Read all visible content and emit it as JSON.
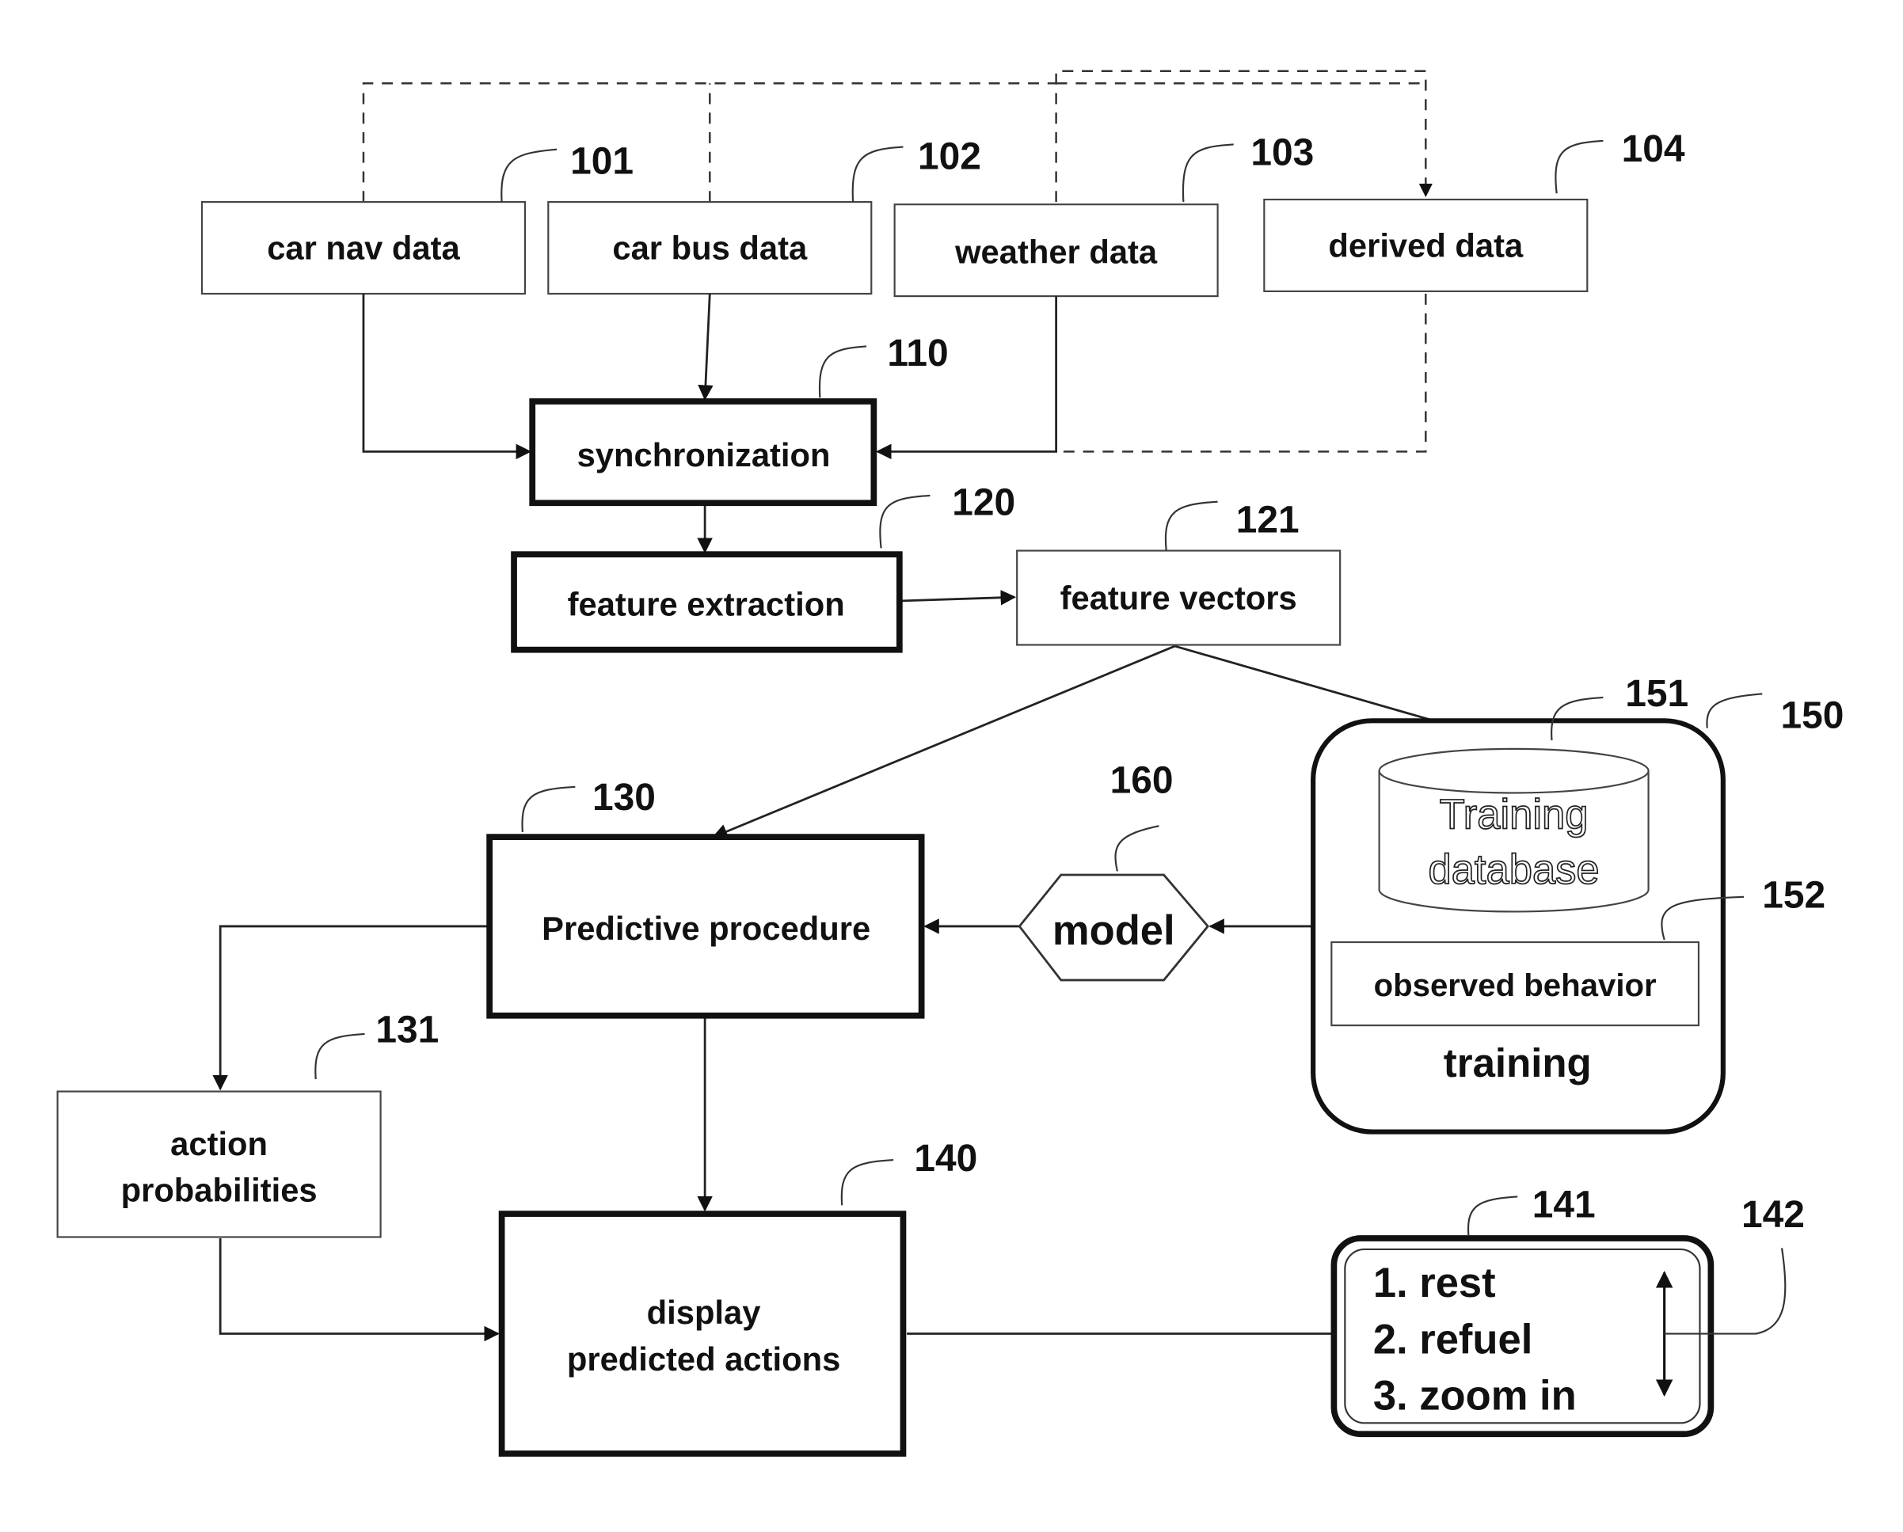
{
  "diagram": {
    "nodes": {
      "car_nav_data": {
        "label": "car nav data",
        "ref": "101"
      },
      "car_bus_data": {
        "label": "car bus data",
        "ref": "102"
      },
      "weather_data": {
        "label": "weather data",
        "ref": "103"
      },
      "derived_data": {
        "label": "derived data",
        "ref": "104"
      },
      "synchronization": {
        "label": "synchronization",
        "ref": "110"
      },
      "feature_extraction": {
        "label": "feature extraction",
        "ref": "120"
      },
      "feature_vectors": {
        "label": "feature vectors",
        "ref": "121"
      },
      "predictive_procedure": {
        "label": "Predictive procedure",
        "ref": "130"
      },
      "action_probabilities": {
        "label_line1": "action",
        "label_line2": "probabilities",
        "ref": "131"
      },
      "display_predicted_actions": {
        "label_line1": "display",
        "label_line2": "predicted actions",
        "ref": "140"
      },
      "predicted_list": {
        "items": [
          "1. rest",
          "2. refuel",
          "3. zoom in"
        ],
        "ref": "141",
        "scroll_ref": "142"
      },
      "training": {
        "label": "training",
        "ref": "150"
      },
      "training_database": {
        "label_line1": "Training",
        "label_line2": "database",
        "ref": "151"
      },
      "observed_behavior": {
        "label": "observed behavior",
        "ref": "152"
      },
      "model": {
        "label": "model",
        "ref": "160"
      }
    },
    "edges": [
      {
        "from": "car nav data",
        "to": "synchronization"
      },
      {
        "from": "car bus data",
        "to": "synchronization"
      },
      {
        "from": "weather data",
        "to": "synchronization"
      },
      {
        "from": "derived data",
        "to": "synchronization",
        "style": "dashed"
      },
      {
        "from": "car nav data",
        "to": "derived data",
        "style": "dashed"
      },
      {
        "from": "car bus data",
        "to": "derived data",
        "style": "dashed"
      },
      {
        "from": "weather data",
        "to": "derived data",
        "style": "dashed"
      },
      {
        "from": "synchronization",
        "to": "feature extraction"
      },
      {
        "from": "feature extraction",
        "to": "feature vectors"
      },
      {
        "from": "feature vectors",
        "to": "Predictive procedure"
      },
      {
        "from": "feature vectors",
        "to": "Training database"
      },
      {
        "from": "Training database",
        "to": "observed behavior"
      },
      {
        "from": "training",
        "to": "model"
      },
      {
        "from": "model",
        "to": "Predictive procedure"
      },
      {
        "from": "Predictive procedure",
        "to": "action probabilities"
      },
      {
        "from": "Predictive procedure",
        "to": "display predicted actions"
      },
      {
        "from": "action probabilities",
        "to": "display predicted actions"
      },
      {
        "from": "display predicted actions",
        "to": "predicted list"
      }
    ]
  }
}
